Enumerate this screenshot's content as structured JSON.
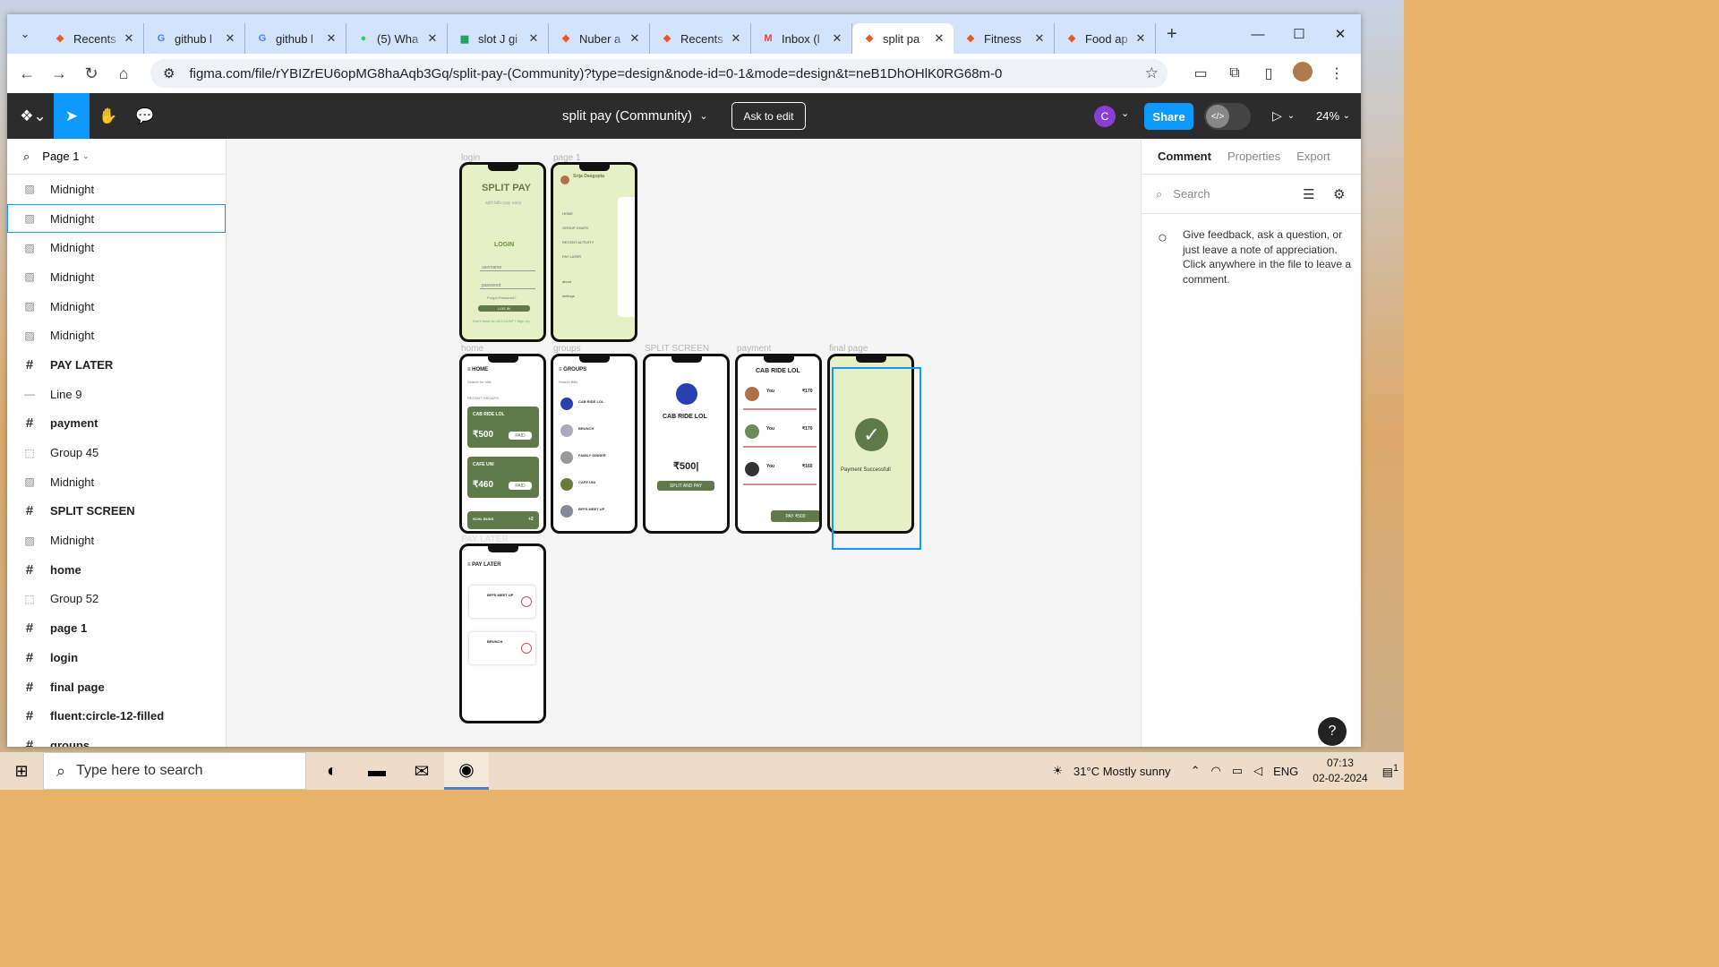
{
  "browser": {
    "tabs": [
      {
        "title": "Recents",
        "icon": "figma-icon",
        "color": "#f24e1e"
      },
      {
        "title": "github l",
        "icon": "google-icon",
        "color": "#4285f4"
      },
      {
        "title": "github l",
        "icon": "google-icon",
        "color": "#4285f4"
      },
      {
        "title": "(5) Wha",
        "icon": "whatsapp-icon",
        "color": "#25d366"
      },
      {
        "title": "slot J gi",
        "icon": "sheets-icon",
        "color": "#0f9d58"
      },
      {
        "title": "Nuber a",
        "icon": "figma-icon",
        "color": "#f24e1e"
      },
      {
        "title": "Recents",
        "icon": "figma-icon",
        "color": "#f24e1e"
      },
      {
        "title": "Inbox (l",
        "icon": "gmail-icon",
        "color": "#ea4335"
      },
      {
        "title": "split pa",
        "icon": "figma-icon",
        "color": "#f24e1e",
        "active": true
      },
      {
        "title": "Fitness",
        "icon": "figma-icon",
        "color": "#f24e1e"
      },
      {
        "title": "Food ap",
        "icon": "figma-icon",
        "color": "#f24e1e"
      }
    ],
    "url": "figma.com/file/rYBIZrEU6opMG8haAqb3Gq/split-pay-(Community)?type=design&node-id=0-1&mode=design&t=neB1DhOHlK0RG68m-0"
  },
  "figma": {
    "file_title": "split pay (Community)",
    "ask_to_edit": "Ask to edit",
    "user_initial": "C",
    "share": "Share",
    "zoom": "24%",
    "page_selector": "Page 1",
    "layers": [
      {
        "name": "Midnight",
        "type": "image"
      },
      {
        "name": "Midnight",
        "type": "image",
        "selected": true
      },
      {
        "name": "Midnight",
        "type": "image"
      },
      {
        "name": "Midnight",
        "type": "image"
      },
      {
        "name": "Midnight",
        "type": "image"
      },
      {
        "name": "Midnight",
        "type": "image"
      },
      {
        "name": "PAY LATER",
        "type": "frame"
      },
      {
        "name": "Line 9",
        "type": "line"
      },
      {
        "name": "payment",
        "type": "frame"
      },
      {
        "name": "Group 45",
        "type": "group"
      },
      {
        "name": "Midnight",
        "type": "image"
      },
      {
        "name": "SPLIT SCREEN",
        "type": "frame"
      },
      {
        "name": "Midnight",
        "type": "image"
      },
      {
        "name": "home",
        "type": "frame"
      },
      {
        "name": "Group 52",
        "type": "group"
      },
      {
        "name": "page 1",
        "type": "frame"
      },
      {
        "name": "login",
        "type": "frame"
      },
      {
        "name": "final page",
        "type": "frame"
      },
      {
        "name": "fluent:circle-12-filled",
        "type": "frame"
      },
      {
        "name": "groups",
        "type": "frame"
      }
    ],
    "right_panel": {
      "tabs": [
        "Comment",
        "Properties",
        "Export"
      ],
      "search_placeholder": "Search",
      "comment_hint": "Give feedback, ask a question, or just leave a note of appreciation. Click anywhere in the file to leave a comment."
    },
    "frames": {
      "login": "login",
      "page1": "page 1",
      "home": "home",
      "groups": "groups",
      "split": "SPLIT SCREEN",
      "payment": "payment",
      "final": "final page",
      "paylater": "PAY LATER"
    },
    "screens": {
      "login_title": "SPLIT PAY",
      "login_sub": "split bills pay easy",
      "login_label": "LOGIN",
      "username": "username",
      "password": "password",
      "forgot": "Forgot Password?",
      "login_btn": "LOG IN",
      "signup": "Don't Have An ACCOUNT? Sign Up",
      "user_name": "Srija Dasgupta",
      "menu": [
        "HOME",
        "GROUP CHATS",
        "RECENT ACTIVITY",
        "PAY LATER",
        "about",
        "settings"
      ],
      "home_title": "HOME",
      "home_search": "Search for bills",
      "recent_groups": "RECENT GROUPS",
      "card1_title": "CAB RIDE LOL",
      "card1_amt": "₹500",
      "card1_status": "PAID",
      "card2_title": "CAFE UNI",
      "card2_amt": "₹460",
      "card2_status": "PAID",
      "card3_title": "SCHL BUDS",
      "card3_extra": "+2",
      "groups_title": "GROUPS",
      "groups_search": "Search Bills",
      "group_names": [
        "CAB RIDE LOL",
        "BRUNCH",
        "FAMILY DINNER",
        "CAFE UNI",
        "BFFS MEET UP"
      ],
      "split_title": "CAB RIDE LOL",
      "split_amt": "₹500|",
      "split_btn": "SPLIT AND PAY",
      "pay_title": "CAB RIDE LOL",
      "pay_rows": [
        {
          "who": "You",
          "amt": "₹170"
        },
        {
          "who": "You",
          "amt": "₹170"
        },
        {
          "who": "You",
          "amt": "₹160"
        }
      ],
      "pay_btn": "PAY ₹500",
      "final_msg": "Payment Successfull",
      "paylater_title": "PAY LATER",
      "pl_items": [
        "BFFS MEET UP",
        "BRUNCH"
      ]
    }
  },
  "taskbar": {
    "search_placeholder": "Type here to search",
    "weather": "31°C  Mostly sunny",
    "lang": "ENG",
    "time": "07:13",
    "date": "02-02-2024",
    "notif_count": "1"
  }
}
